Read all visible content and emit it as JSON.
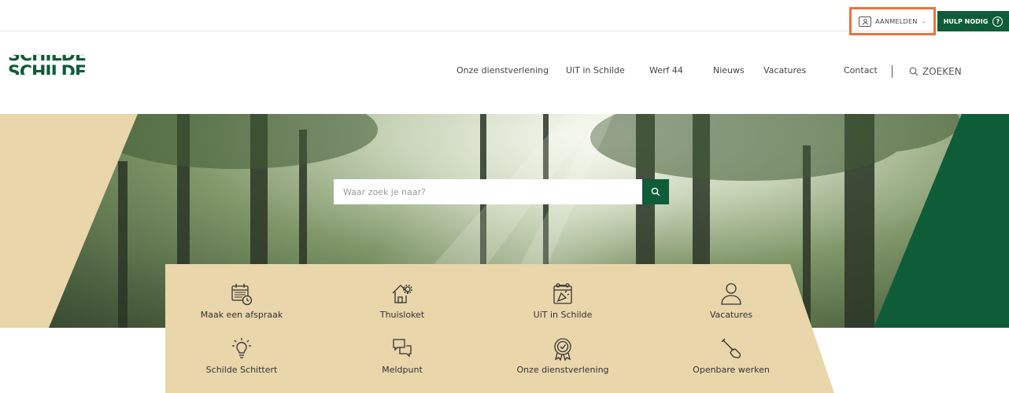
{
  "topbar": {
    "login_label": "AANMELDEN",
    "help_label": "HULP NODIG"
  },
  "logo": {
    "line1": "SCHILDE",
    "line2": "SCHILDE"
  },
  "nav": {
    "items": [
      "Onze dienstverlening",
      "UiT in Schilde",
      "Werf 44",
      "Nieuws",
      "Vacatures",
      "Contact"
    ],
    "search_label": "ZOEKEN"
  },
  "hero": {
    "search_placeholder": "Waar zoek je naar?"
  },
  "quicklinks": [
    {
      "label": "Maak een afspraak",
      "icon": "calendar-clock-icon"
    },
    {
      "label": "Thuisloket",
      "icon": "house-gear-icon"
    },
    {
      "label": "UiT in Schilde",
      "icon": "calendar-party-icon"
    },
    {
      "label": "Vacatures",
      "icon": "person-icon"
    },
    {
      "label": "Schilde Schittert",
      "icon": "lightbulb-icon"
    },
    {
      "label": "Meldpunt",
      "icon": "chat-bubbles-icon"
    },
    {
      "label": "Onze dienstverlening",
      "icon": "award-badge-icon"
    },
    {
      "label": "Openbare werken",
      "icon": "shovel-icon"
    }
  ],
  "colors": {
    "brand_green": "#0f5c38",
    "sand": "#e9d6ab",
    "highlight": "#e8743b"
  }
}
